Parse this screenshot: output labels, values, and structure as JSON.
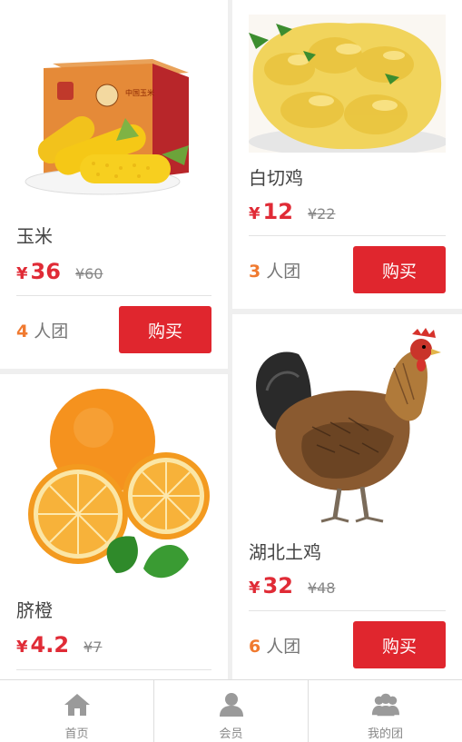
{
  "products": [
    {
      "name": "玉米",
      "currency": "¥",
      "price": "36",
      "old_price": "¥60",
      "group_count": "4",
      "group_unit": "人团",
      "buy_label": "购买",
      "image": "corn-box-image"
    },
    {
      "name": "白切鸡",
      "currency": "¥",
      "price": "12",
      "old_price": "¥22",
      "group_count": "3",
      "group_unit": "人团",
      "buy_label": "购买",
      "image": "sliced-chicken-image"
    },
    {
      "name": "脐橙",
      "currency": "¥",
      "price": "4.2",
      "old_price": "¥7",
      "image": "orange-image"
    },
    {
      "name": "湖北土鸡",
      "currency": "¥",
      "price": "32",
      "old_price": "¥48",
      "group_count": "6",
      "group_unit": "人团",
      "buy_label": "购买",
      "image": "hen-image"
    }
  ],
  "tabbar": [
    {
      "label": "首页",
      "icon": "home-icon"
    },
    {
      "label": "会员",
      "icon": "user-icon"
    },
    {
      "label": "我的团",
      "icon": "group-icon"
    }
  ],
  "colors": {
    "accent": "#e0262e",
    "price": "#e02b36",
    "group_count": "#f07a30"
  }
}
